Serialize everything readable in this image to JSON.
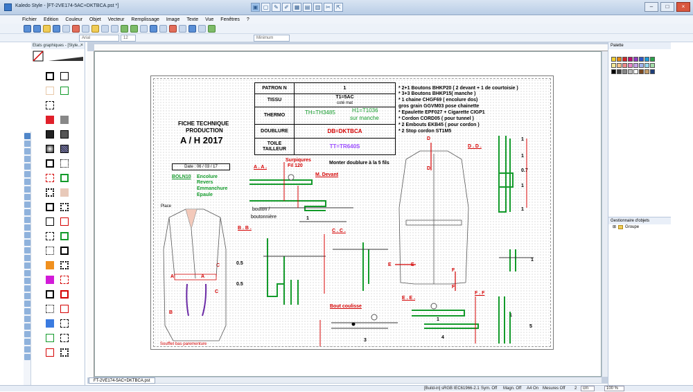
{
  "window": {
    "title": "Kaledo Style - [FT-2VE174-5AC+DKTBCA.pst *]",
    "minimize": "–",
    "maximize": "□",
    "close": "×"
  },
  "menu": [
    "Fichier",
    "Edition",
    "Couleur",
    "Objet",
    "Vecteur",
    "Remplissage",
    "Image",
    "Texte",
    "Vue",
    "Fenêtres",
    "?"
  ],
  "toolbar2": {
    "font": "Arial",
    "size": "12",
    "line_mode": "Minimum"
  },
  "left_panel": {
    "title": "Etats graphiques - [Style..."
  },
  "palette_panel": {
    "title": "Palette"
  },
  "objects_panel": {
    "title": "Gestionnaire d'objets",
    "tree_item": "Groupe"
  },
  "document_tab": "FT-2VE174-5AC+DKTBCA.pst",
  "status": {
    "color_profile": "[Build-in] sRGB IEC61966-2.1",
    "sym": "Sym. Off",
    "magn": "Magn. Off",
    "page": "A4 On",
    "mesures": "Mesures Off",
    "mesures_count": "2",
    "unit": "cm",
    "zoom": "100 %"
  },
  "colors": {
    "accent": "#3a78c9",
    "red": "#d40000",
    "green": "#129a2a",
    "violet": "#9a4bff"
  },
  "sheet": {
    "header_left": {
      "line1": "FICHE TECHNIQUE",
      "line2": "PRODUCTION",
      "season": "A / H 2017"
    },
    "date": "Date : 06 / 03 / 17",
    "table": {
      "rows": [
        {
          "label": "PATRON N",
          "value": "1"
        },
        {
          "label": "TISSU",
          "value": "T1=5AC",
          "value2": "coté mat"
        },
        {
          "label": "THERMO",
          "value": "TH=TH3485",
          "value2": "H1=T1036",
          "value3": "sur manche"
        },
        {
          "label": "DOUBLURE",
          "value": "DB=DKTBCA"
        },
        {
          "label": "TOILE TAILLEUR",
          "value": "TT=TR640S"
        }
      ]
    },
    "notes": [
      "* 2+1 Boutons BHKP20  ( 2 devant + 1 de courtoisie )",
      "* 3+3 Boutons  BHKP15( manche )",
      "* 1 chaine CHGF69 ( encolure dos)",
      "  gros grain GGVM03 pose chainette",
      "* Epaulette  EPF027 + Cigarette CIGP1",
      "* Cordon CORD05  ( pour tunnel )",
      "* 2 Embouts EKB45  ( pour cordon )",
      "* 2 Stop cordon ST1M5"
    ],
    "boln": {
      "code": "BOLN10",
      "items": [
        "Encolure",
        "Revers",
        "Emmanchure",
        "Epaule"
      ]
    },
    "labels": {
      "place": "Place",
      "surpiqures": "Surpiqures",
      "fil": "Fil 120",
      "monter": "Monter doublure à la 5 fils",
      "bouton": "bouton /",
      "boutonniere": "boutonnière",
      "bout_coulisse": "Bout coulisse",
      "soufflet": "Soufflet bas parementure",
      "sections": [
        "A . A .",
        "M. Devant",
        "B . B .",
        "C . C .",
        "D . D .",
        "E . E .",
        "F . F"
      ],
      "markers": [
        "D",
        "D",
        "E",
        "E",
        "F",
        "F",
        "A",
        "A",
        "B",
        "C",
        "C"
      ],
      "dims": [
        "1",
        "1",
        "0.7",
        "1",
        "1",
        "0.5",
        "0.5",
        "1",
        "3",
        "1",
        "1",
        "5",
        "4",
        "1"
      ]
    }
  }
}
